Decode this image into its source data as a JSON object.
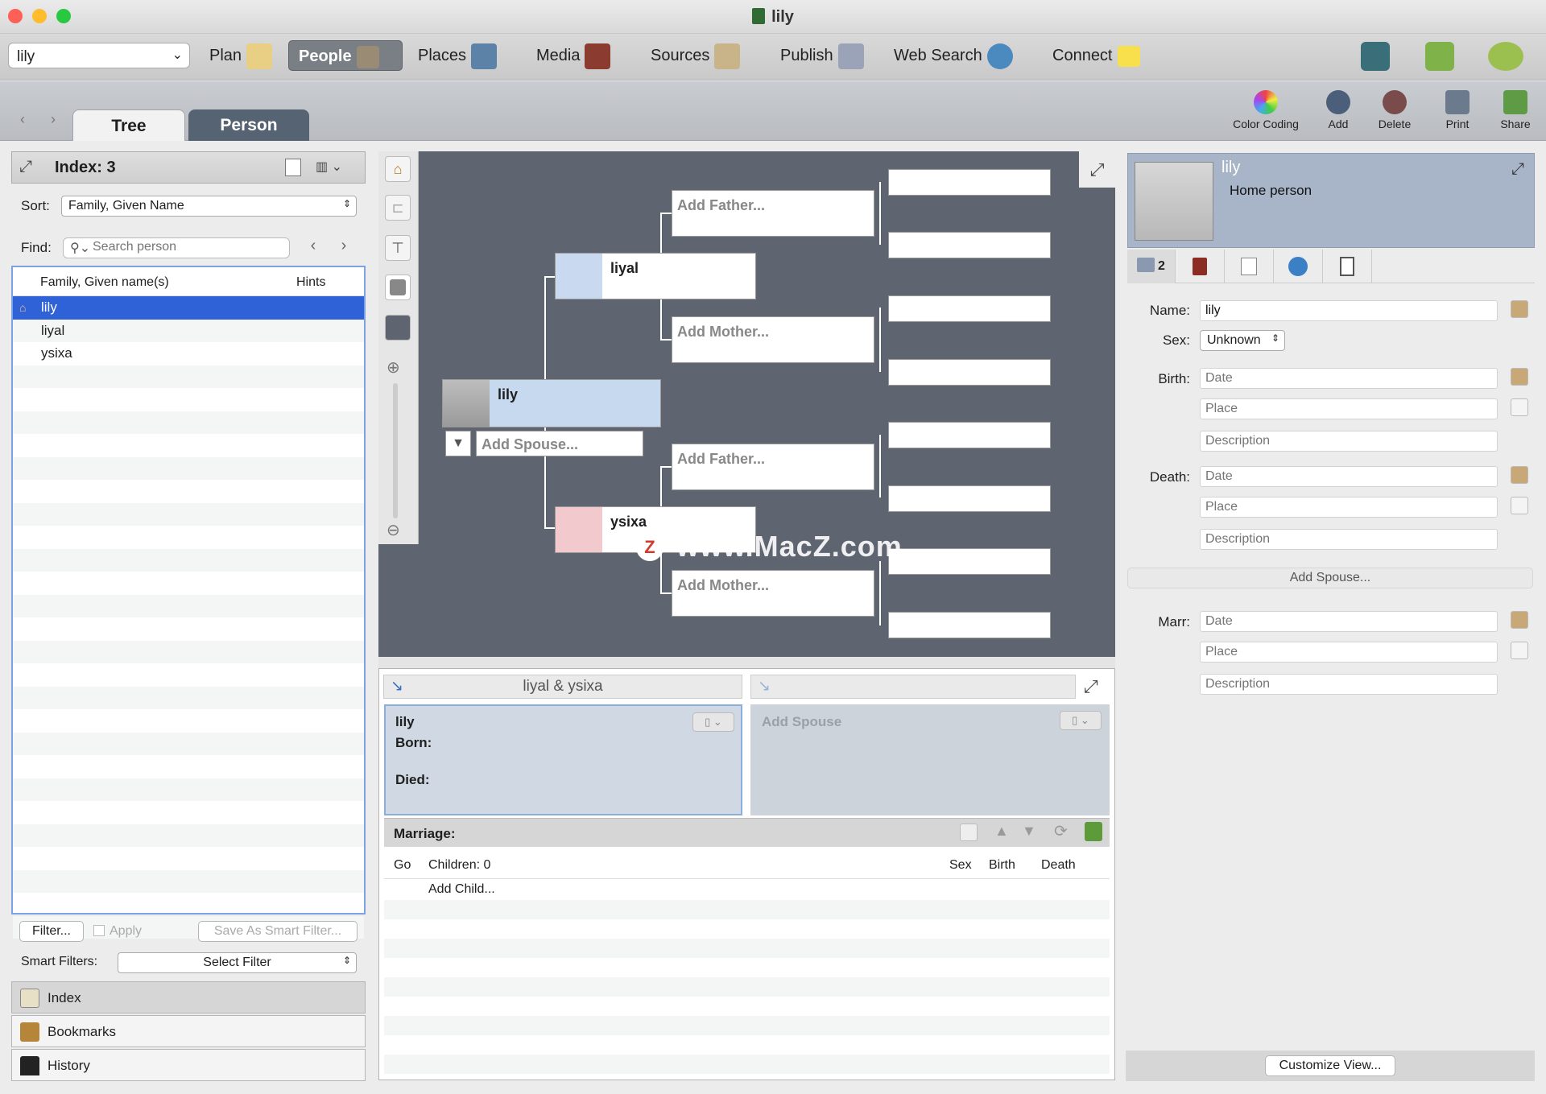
{
  "window": {
    "title": "lily"
  },
  "toolbar": {
    "tree_combo": "lily",
    "items": [
      "Plan",
      "People",
      "Places",
      "Media",
      "Sources",
      "Publish",
      "Web Search",
      "Connect"
    ]
  },
  "tabs": {
    "tree": "Tree",
    "person": "Person"
  },
  "actions": {
    "color_coding": "Color Coding",
    "add": "Add",
    "delete": "Delete",
    "print": "Print",
    "share": "Share"
  },
  "left": {
    "index_title": "Index: 3",
    "sort_label": "Sort:",
    "sort_value": "Family, Given Name",
    "find_label": "Find:",
    "search_placeholder": "Search person",
    "col_name": "Family, Given name(s)",
    "col_hints": "Hints",
    "rows": [
      "lily",
      "liyal",
      "ysixa"
    ],
    "filter": "Filter...",
    "apply": "Apply",
    "save_smart": "Save As Smart Filter...",
    "smart_label": "Smart Filters:",
    "smart_value": "Select Filter",
    "drawers": [
      "Index",
      "Bookmarks",
      "History"
    ]
  },
  "tree": {
    "home": "lily",
    "add_spouse": "Add Spouse...",
    "father_box": "liyal",
    "mother_box": "ysixa",
    "add_father": "Add Father...",
    "add_mother": "Add Mother...",
    "watermark": "www.MacZ.com"
  },
  "family": {
    "title": "liyal & ysixa",
    "person": "lily",
    "born": "Born:",
    "died": "Died:",
    "add_spouse": "Add Spouse",
    "marriage": "Marriage:",
    "cols": [
      "Go",
      "Children: 0",
      "Sex",
      "Birth",
      "Death"
    ],
    "add_child": "Add Child..."
  },
  "editor": {
    "name": "lily",
    "subtitle": "Home person",
    "tab_count": "2",
    "name_label": "Name:",
    "name_value": "lily",
    "sex_label": "Sex:",
    "sex_value": "Unknown",
    "birth_label": "Birth:",
    "death_label": "Death:",
    "marr_label": "Marr:",
    "date_ph": "Date",
    "place_ph": "Place",
    "desc_ph": "Description",
    "add_spouse": "Add Spouse...",
    "customize": "Customize View..."
  }
}
